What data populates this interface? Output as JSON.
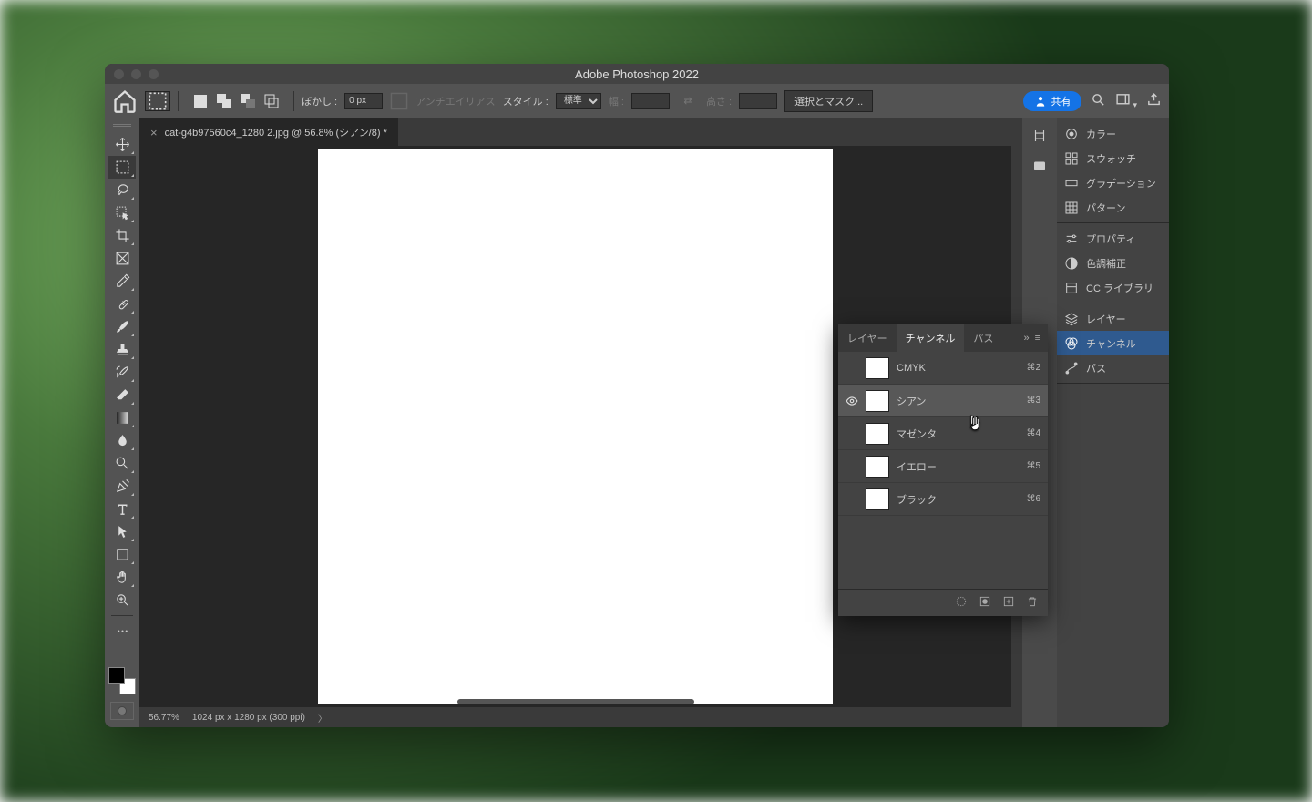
{
  "window": {
    "title": "Adobe Photoshop 2022"
  },
  "options_bar": {
    "feather_label": "ぼかし :",
    "feather_value": "0 px",
    "antialias_label": "アンチエイリアス",
    "style_label": "スタイル :",
    "style_value": "標準",
    "width_label": "幅 :",
    "height_label": "高さ :",
    "mask_button": "選択とマスク...",
    "share_label": "共有"
  },
  "tab": {
    "filename": "cat-g4b97560c4_1280 2.jpg @ 56.8% (シアン/8) *"
  },
  "status_bar": {
    "zoom": "56.77%",
    "info": "1024 px x 1280 px (300 ppi)"
  },
  "side_panels": {
    "color": "カラー",
    "swatches": "スウォッチ",
    "gradients": "グラデーション",
    "patterns": "パターン",
    "properties": "プロパティ",
    "adjustments": "色調補正",
    "libraries": "CC ライブラリ",
    "layers": "レイヤー",
    "channels": "チャンネル",
    "paths": "パス"
  },
  "channels_panel": {
    "tab_layers": "レイヤー",
    "tab_channels": "チャンネル",
    "tab_paths": "パス",
    "items": [
      {
        "name": "CMYK",
        "shortcut": "⌘2",
        "visible": false,
        "selected": false
      },
      {
        "name": "シアン",
        "shortcut": "⌘3",
        "visible": true,
        "selected": true
      },
      {
        "name": "マゼンタ",
        "shortcut": "⌘4",
        "visible": false,
        "selected": false
      },
      {
        "name": "イエロー",
        "shortcut": "⌘5",
        "visible": false,
        "selected": false
      },
      {
        "name": "ブラック",
        "shortcut": "⌘6",
        "visible": false,
        "selected": false
      }
    ]
  }
}
